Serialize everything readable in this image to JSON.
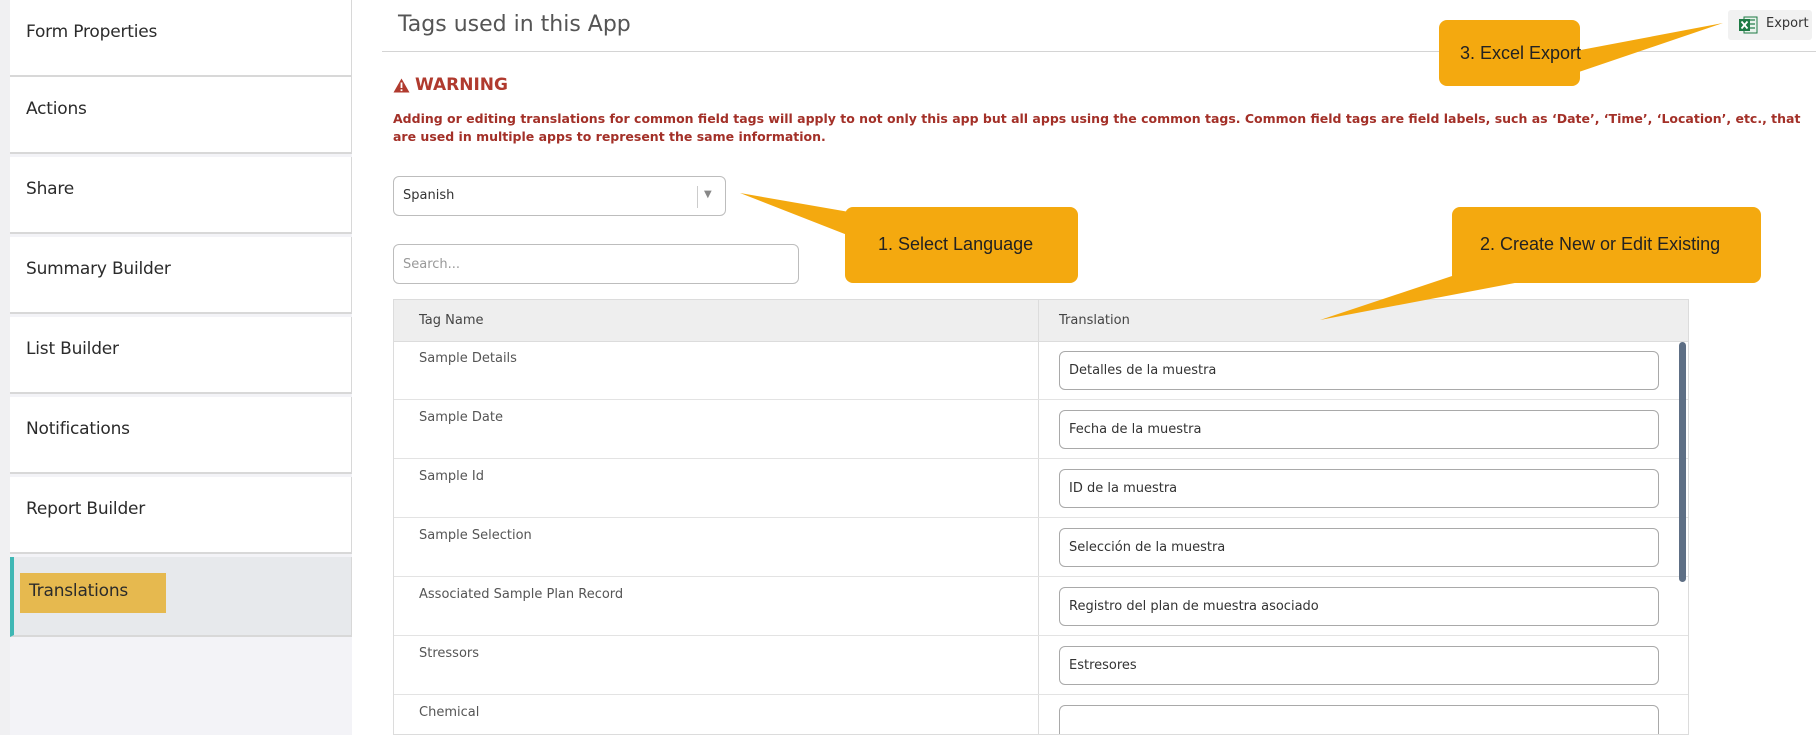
{
  "sidebar": {
    "items": [
      {
        "label": "Form Properties"
      },
      {
        "label": "Actions"
      },
      {
        "label": "Share"
      },
      {
        "label": "Summary Builder"
      },
      {
        "label": "List Builder"
      },
      {
        "label": "Notifications"
      },
      {
        "label": "Report Builder"
      },
      {
        "label": "Translations",
        "active": true
      }
    ]
  },
  "header": {
    "title": "Tags used in this App",
    "export_label": "Export",
    "export_icon": "excel-icon"
  },
  "warning": {
    "title": "WARNING",
    "icon": "warning-triangle-icon",
    "text": "Adding or editing translations for common field tags will apply to not only this app but all apps using the common tags. Common field tags are field labels, such as ‘Date’, ‘Time’, ‘Location’, etc., that are used in multiple apps to represent the same information."
  },
  "language_select": {
    "value": "Spanish"
  },
  "search": {
    "placeholder": "Search..."
  },
  "table": {
    "columns": [
      "Tag Name",
      "Translation"
    ],
    "rows": [
      {
        "tag": "Sample Details",
        "translation": "Detalles de la muestra"
      },
      {
        "tag": "Sample Date",
        "translation": "Fecha de la muestra"
      },
      {
        "tag": "Sample Id",
        "translation": "ID de la muestra"
      },
      {
        "tag": "Sample Selection",
        "translation": "Selección de la muestra"
      },
      {
        "tag": "Associated Sample Plan Record",
        "translation": "Registro del plan de muestra asociado"
      },
      {
        "tag": "Stressors",
        "translation": "Estresores"
      },
      {
        "tag": "Chemical",
        "translation": ""
      }
    ]
  },
  "callouts": {
    "select_language": "1. Select Language",
    "create_edit": "2. Create New or Edit Existing",
    "excel_export": "3. Excel Export"
  },
  "colors": {
    "callout": "#f4a90f",
    "warning": "#b03a2e",
    "active_highlight": "#e6b94f",
    "active_accent": "#3fb7b4"
  }
}
